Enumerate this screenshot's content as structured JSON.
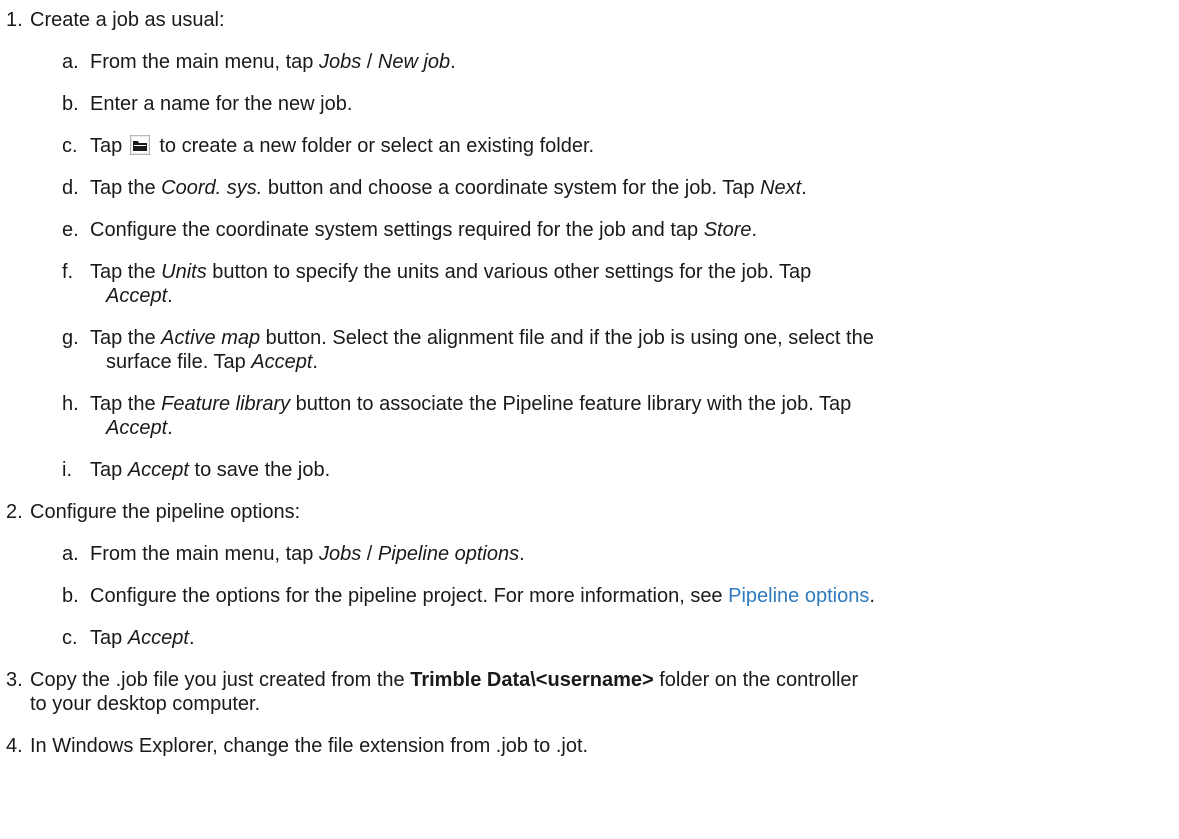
{
  "steps": [
    {
      "num": "1.",
      "text": "Create a job as usual:",
      "subs": [
        {
          "letter": "a.",
          "t1": "From the main menu, tap ",
          "i1": "Jobs",
          "t2": " / ",
          "i2": "New job",
          "t3": "."
        },
        {
          "letter": "b.",
          "t1": "Enter a name for the new job."
        },
        {
          "letter": "c.",
          "t1": "Tap",
          "t2": "to create a new folder or select an existing folder.",
          "icon": "folder-icon"
        },
        {
          "letter": "d.",
          "t1": "Tap the ",
          "i1": "Coord. sys.",
          "t2": " button and choose a coordinate system for the job. Tap ",
          "i2": "Next",
          "t3": "."
        },
        {
          "letter": "e.",
          "t1": "Configure the coordinate system settings required for the job and tap ",
          "i1": "Store",
          "t2": "."
        },
        {
          "letter": "f.",
          "t1": "Tap the ",
          "i1": "Units",
          "t2": " button to specify the units and various other settings for the job. Tap",
          "i2": "Accept",
          "t3": "."
        },
        {
          "letter": "g.",
          "t1": "Tap the ",
          "i1": "Active map",
          "t2": " button. Select the alignment file and if the job is using one, select the",
          "t3": "surface file. Tap ",
          "i2": "Accept",
          "t4": "."
        },
        {
          "letter": "h.",
          "t1": "Tap the ",
          "i1": "Feature library",
          "t2": " button to associate the Pipeline feature library with the job. Tap",
          "i2": "Accept",
          "t3": "."
        },
        {
          "letter": "i.",
          "t1": "Tap ",
          "i1": "Accept",
          "t2": " to save the job."
        }
      ]
    },
    {
      "num": "2.",
      "text": "Configure the pipeline options:",
      "subs": [
        {
          "letter": "a.",
          "t1": "From the main menu, tap ",
          "i1": "Jobs",
          "t2": " / ",
          "i2": "Pipeline options",
          "t3": "."
        },
        {
          "letter": "b.",
          "t1": "Configure the options for the pipeline project. For more information, see ",
          "link": "Pipeline options",
          "t2": "."
        },
        {
          "letter": "c.",
          "t1": "Tap ",
          "i1": "Accept",
          "t2": "."
        }
      ]
    },
    {
      "num": "3.",
      "t1": "Copy the .job file you just created from the ",
      "b1": "Trimble Data\\<username>",
      "t2": " folder on the controller",
      "t3": "to your desktop computer."
    },
    {
      "num": "4.",
      "text": "In Windows Explorer, change the file extension from .job to .jot."
    }
  ],
  "colors": {
    "text": "#1a1a1a",
    "link": "#2f7bbd"
  }
}
